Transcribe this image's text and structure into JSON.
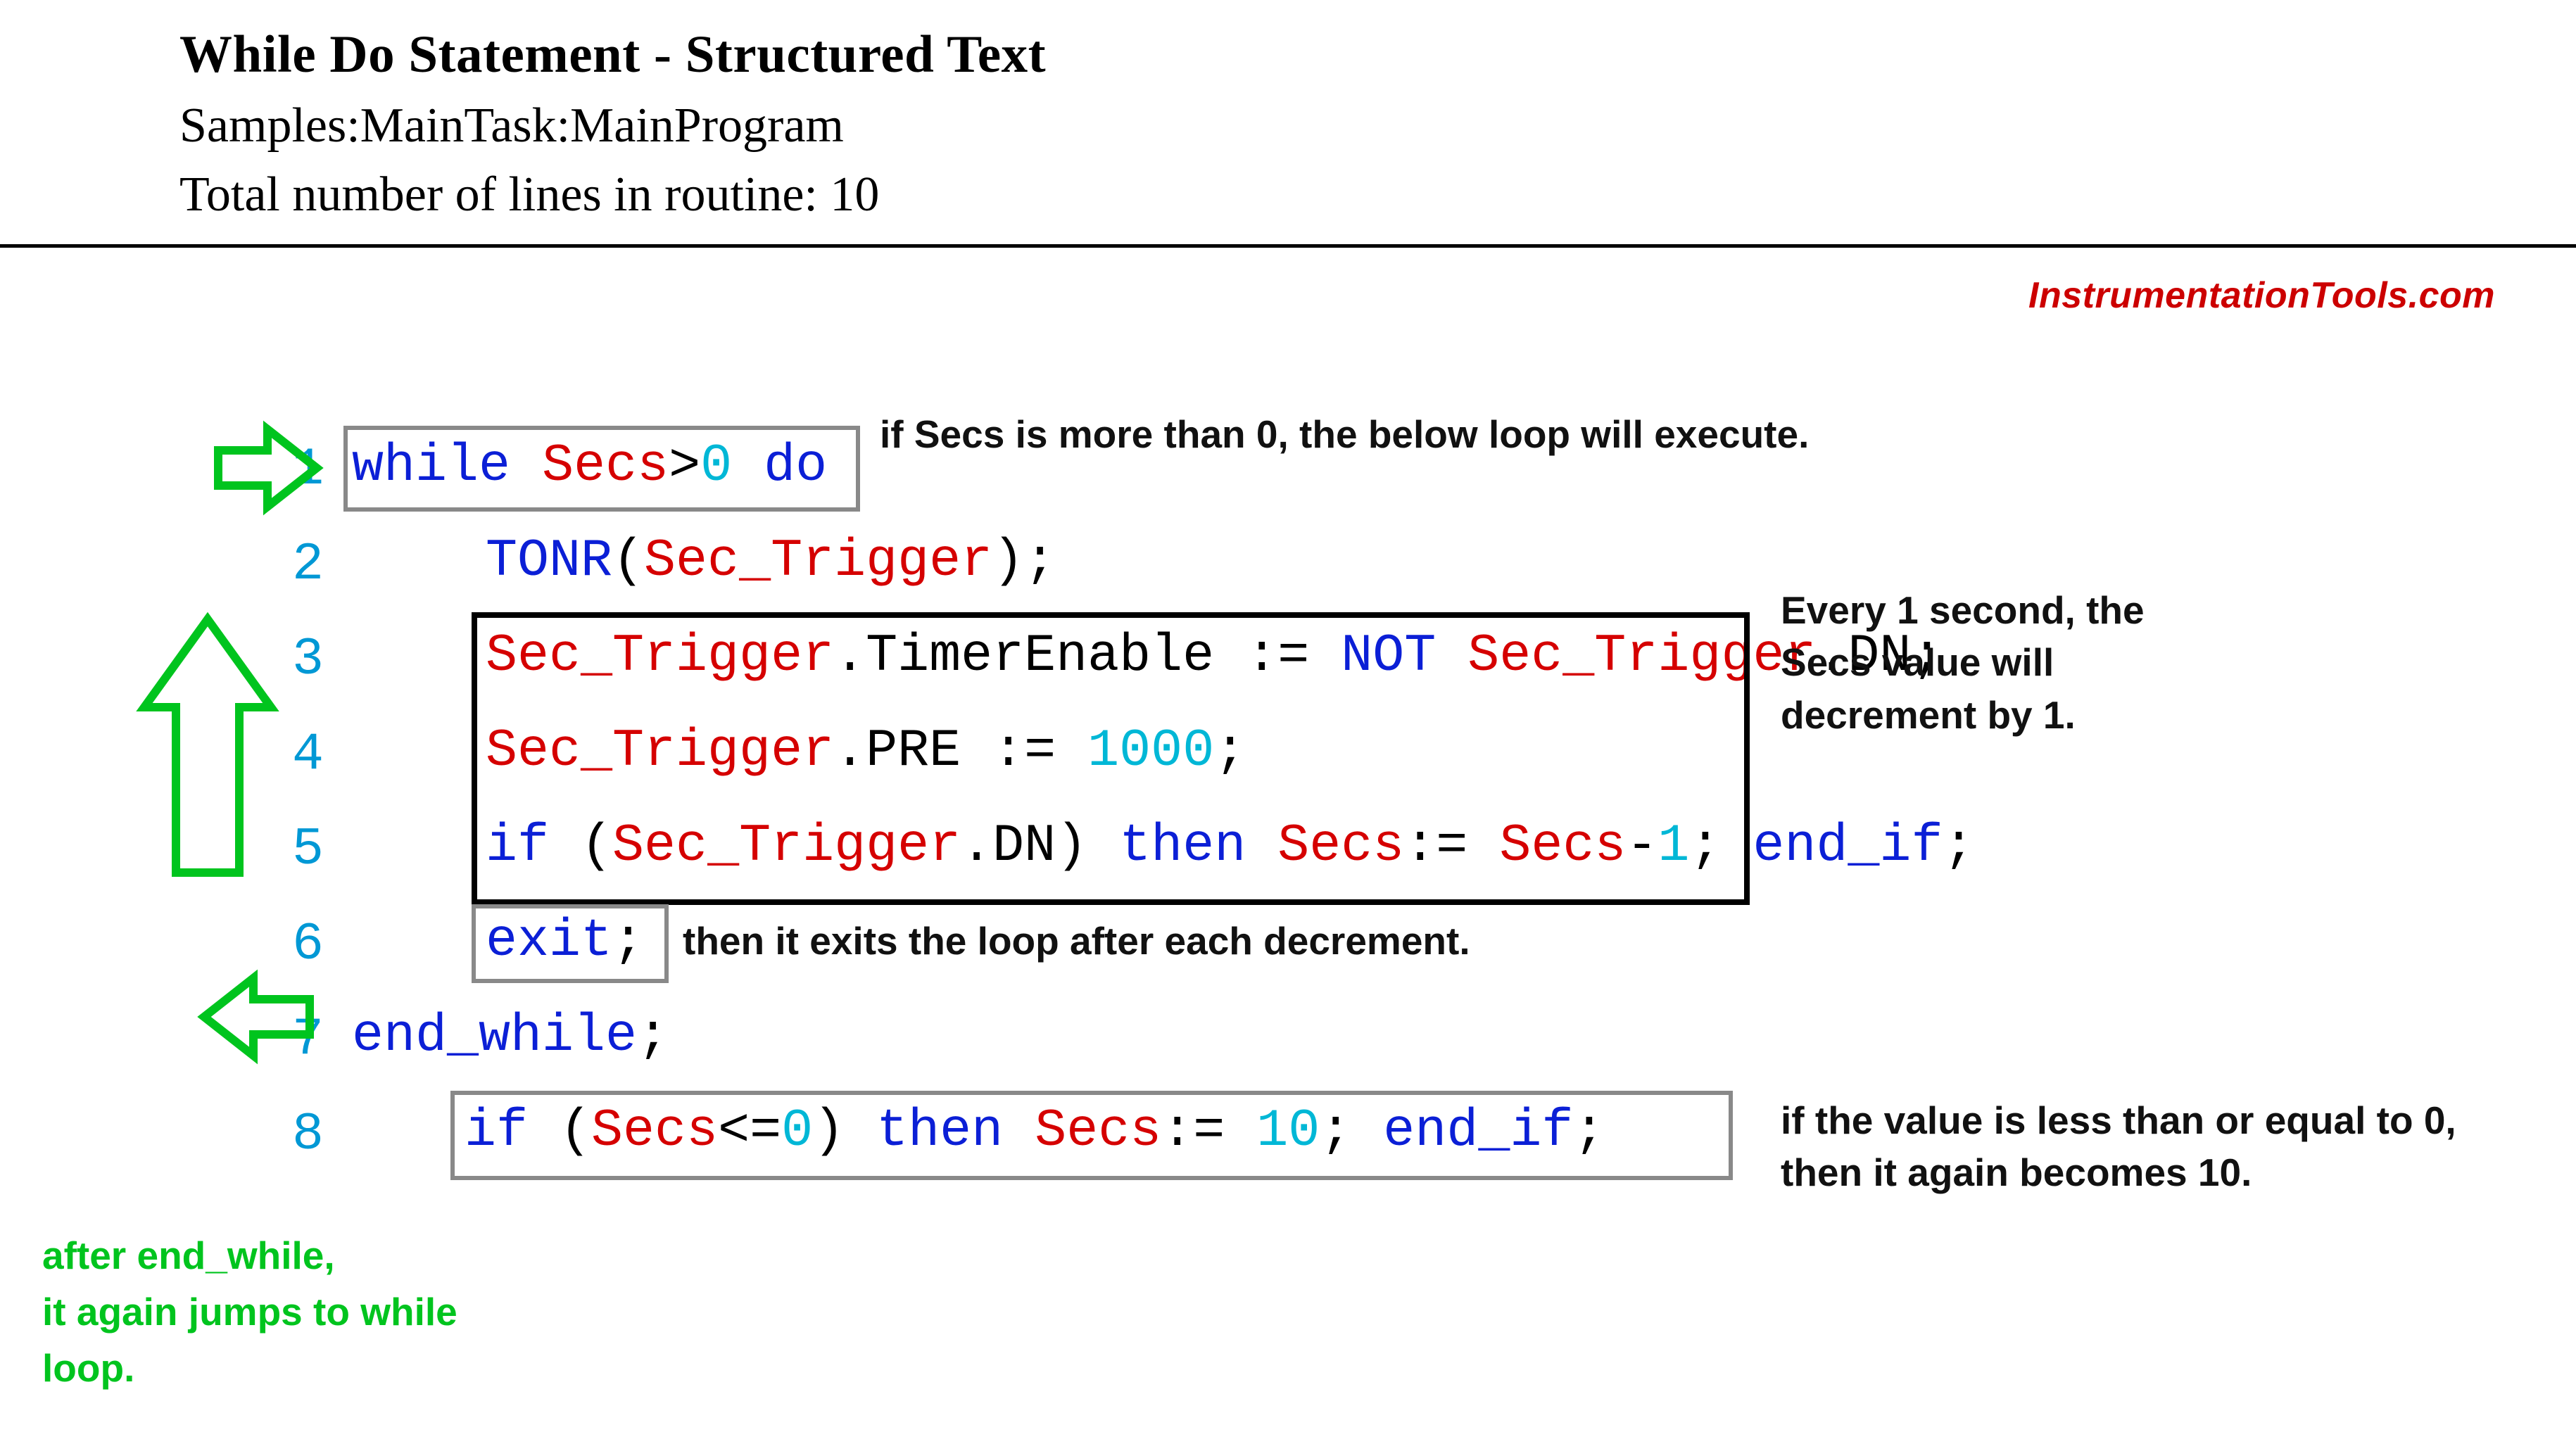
{
  "header": {
    "title": "While  Do  Statement - Structured Text",
    "subtitle": "Samples:MainTask:MainProgram",
    "linecount": "Total number of lines in routine: 10"
  },
  "watermark": "InstrumentationTools.com",
  "code": {
    "lines": {
      "l1n": "1",
      "l1_while": "while",
      "l1_secs": "Secs",
      "l1_gt": ">",
      "l1_zero": "0",
      "l1_do": "do",
      "l2n": "2",
      "l2_tonr": "TONR",
      "l2_arg": "Sec_Trigger",
      "l3n": "3",
      "l3_obj": "Sec_Trigger",
      "l3_mem1": ".TimerEnable",
      "l3_assign": ":=",
      "l3_not": "NOT",
      "l3_obj2": "Sec_Trigger",
      "l3_mem2": ".DN",
      "l4n": "4",
      "l4_obj": "Sec_Trigger",
      "l4_mem": ".PRE",
      "l4_assign": ":=",
      "l4_val": "1000",
      "l5n": "5",
      "l5_if": "if",
      "l5_obj": "Sec_Trigger",
      "l5_mem": ".DN",
      "l5_then": "then",
      "l5_secs": "Secs",
      "l5_assign": ":=",
      "l5_secs2": "Secs",
      "l5_minus": "-",
      "l5_one": "1",
      "l5_endif": "end_if",
      "l6n": "6",
      "l6_exit": "exit",
      "l7n": "7",
      "l7_endwhile": "end_while",
      "l8n": "8",
      "l8_if": "if",
      "l8_secs": "Secs",
      "l8_le": "<=",
      "l8_zero": "0",
      "l8_then": "then",
      "l8_secs2": "Secs",
      "l8_assign": ":=",
      "l8_ten": "10",
      "l8_endif": "end_if"
    }
  },
  "annotations": {
    "a1": "if Secs is more than 0, the below loop will execute.",
    "a2_l1": "Every 1 second, the",
    "a2_l2": "Secs value will",
    "a2_l3": "decrement by 1.",
    "a3": "then it exits the loop after each decrement.",
    "a4_l1": "if the value is less than or equal to 0,",
    "a4_l2": "then it again becomes 10.",
    "g1_l1": "after end_while,",
    "g1_l2": "it again jumps to while",
    "g1_l3": "loop."
  }
}
